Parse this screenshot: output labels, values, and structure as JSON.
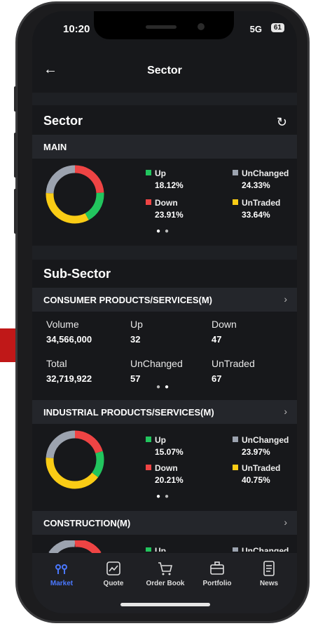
{
  "status": {
    "time": "10:20",
    "network": "5G",
    "battery": "61"
  },
  "header": {
    "title": "Sector"
  },
  "sector": {
    "title": "Sector",
    "main": {
      "label": "MAIN",
      "up_label": "Up",
      "up_value": "18.12%",
      "down_label": "Down",
      "down_value": "23.91%",
      "unchanged_label": "UnChanged",
      "unchanged_value": "24.33%",
      "untraded_label": "UnTraded",
      "untraded_value": "33.64%"
    }
  },
  "subsector": {
    "title": "Sub-Sector",
    "consumer": {
      "label": "CONSUMER PRODUCTS/SERVICES(M)",
      "volume_label": "Volume",
      "volume_value": "34,566,000",
      "up_label": "Up",
      "up_value": "32",
      "down_label": "Down",
      "down_value": "47",
      "total_label": "Total",
      "total_value": "32,719,922",
      "unchanged_label": "UnChanged",
      "unchanged_value": "57",
      "untraded_label": "UnTraded",
      "untraded_value": "67"
    },
    "industrial": {
      "label": "INDUSTRIAL PRODUCTS/SERVICES(M)",
      "up_label": "Up",
      "up_value": "15.07%",
      "down_label": "Down",
      "down_value": "20.21%",
      "unchanged_label": "UnChanged",
      "unchanged_value": "23.97%",
      "untraded_label": "UnTraded",
      "untraded_value": "40.75%"
    },
    "construction": {
      "label": "CONSTRUCTION(M)",
      "up_label": "Up",
      "unchanged_label": "UnChanged"
    }
  },
  "tabs": [
    {
      "label": "Market",
      "icon": "market-icon",
      "active": true
    },
    {
      "label": "Quote",
      "icon": "chart-icon"
    },
    {
      "label": "Order Book",
      "icon": "cart-icon"
    },
    {
      "label": "Portfolio",
      "icon": "briefcase-icon"
    },
    {
      "label": "News",
      "icon": "document-icon"
    }
  ],
  "colors": {
    "up": "#22c55e",
    "down": "#ef4444",
    "unchanged": "#9ca3af",
    "untraded": "#facc15",
    "accent": "#4a78ff"
  }
}
